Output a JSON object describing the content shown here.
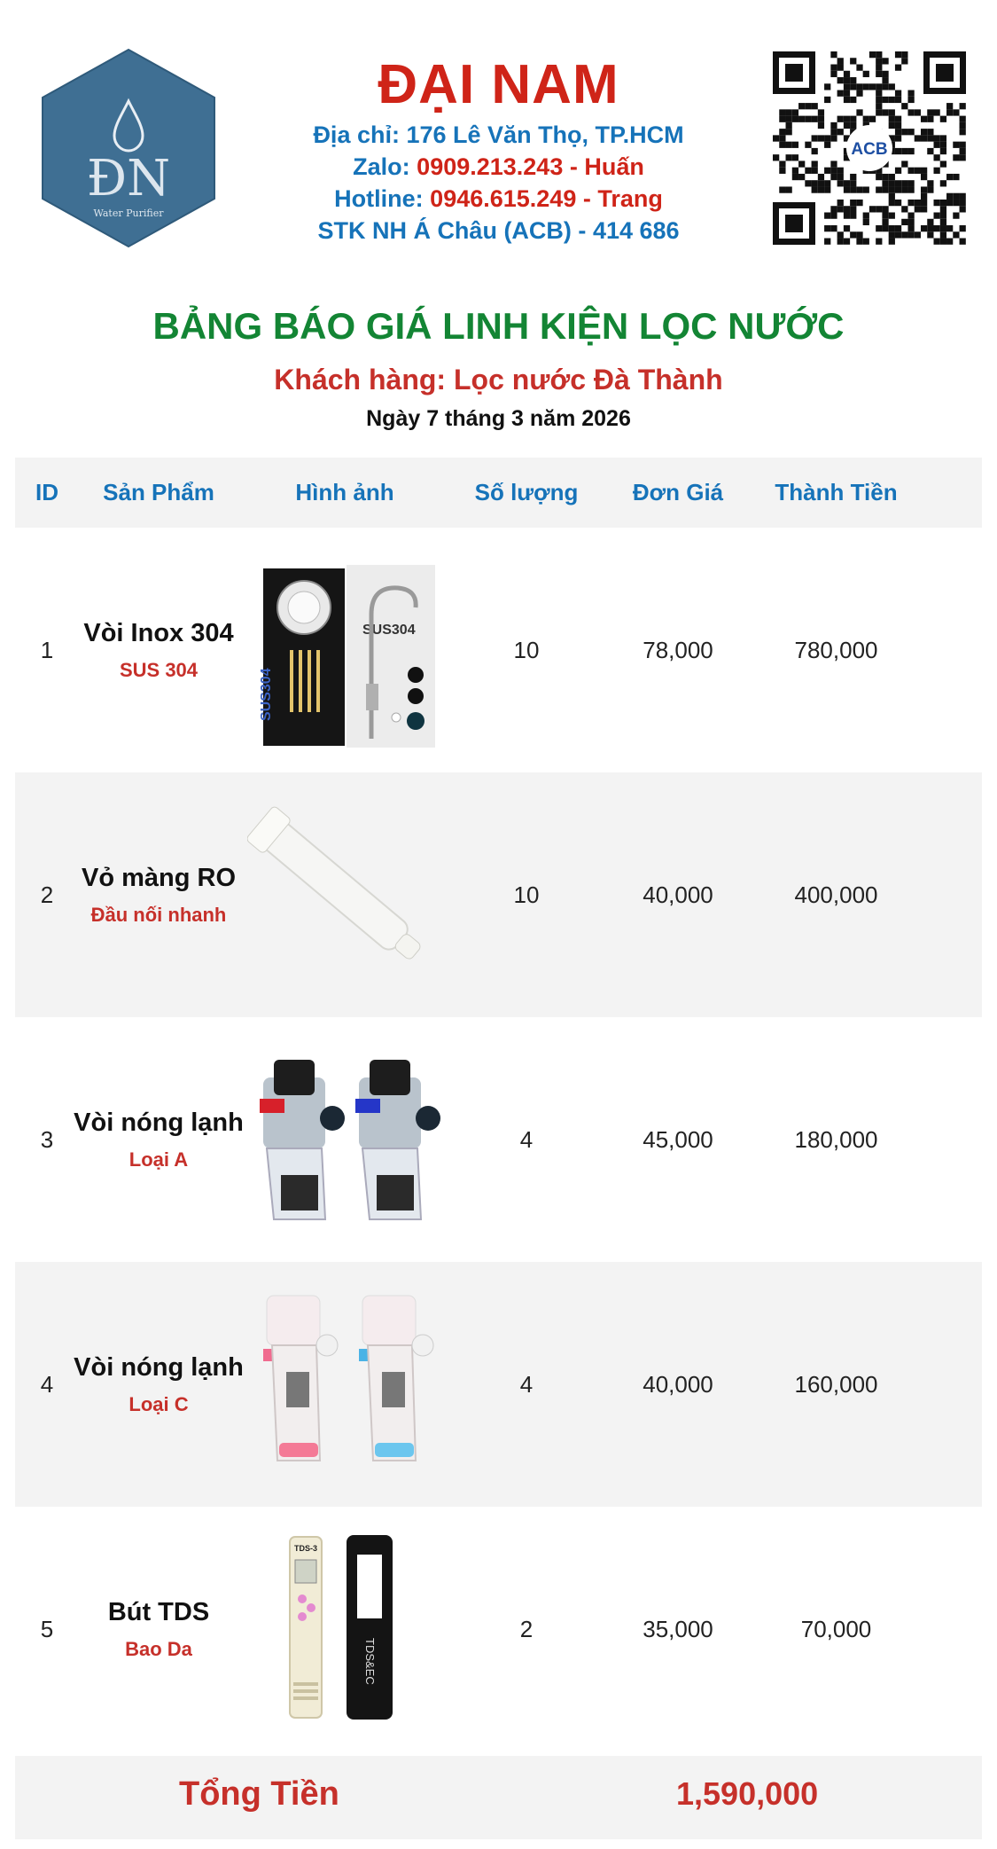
{
  "header": {
    "company_name": "ĐẠI NAM",
    "address_label": "Địa chỉ:",
    "address_value": "176 Lê Văn Thọ, TP.HCM",
    "zalo_label": "Zalo:",
    "zalo_value": "0909.213.243 - Huấn",
    "hotline_label": "Hotline:",
    "hotline_value": "0946.615.249 - Trang",
    "bank_label": "STK NH Á Châu (ACB) -",
    "bank_value": "414 686",
    "logo_text": "ĐN",
    "logo_subtext": "Water Purifier",
    "qr_badge": "ACB"
  },
  "title": "BẢNG BÁO GIÁ LINH KIỆN LỌC NƯỚC",
  "customer": "Khách hàng: Lọc nước Đà Thành",
  "date": "Ngày 7 tháng 3 năm 2026",
  "table": {
    "headers": [
      "ID",
      "Sản Phẩm",
      "Hình ảnh",
      "Số lượng",
      "Đơn Giá",
      "Thành Tiền"
    ],
    "rows": [
      {
        "id": "1",
        "name": "Vòi Inox 304",
        "sub": "SUS 304",
        "image": "faucet-box-image",
        "qty": "10",
        "price": "78,000",
        "total": "780,000"
      },
      {
        "id": "2",
        "name": "Vỏ màng RO",
        "sub": "Đầu nối nhanh",
        "image": "ro-housing-image",
        "qty": "10",
        "price": "40,000",
        "total": "400,000"
      },
      {
        "id": "3",
        "name": "Vòi nóng lạnh",
        "sub": "Loại A",
        "image": "hot-cold-tap-a-image",
        "qty": "4",
        "price": "45,000",
        "total": "180,000"
      },
      {
        "id": "4",
        "name": "Vòi nóng lạnh",
        "sub": "Loại C",
        "image": "hot-cold-tap-c-image",
        "qty": "4",
        "price": "40,000",
        "total": "160,000"
      },
      {
        "id": "5",
        "name": "Bút TDS",
        "sub": "Bao Da",
        "image": "tds-pen-image",
        "qty": "2",
        "price": "35,000",
        "total": "70,000"
      }
    ]
  },
  "product_image_text": {
    "sus_label": "SUS304",
    "sus_vertical": "SUS304",
    "tds_label": "TDS-3",
    "tds_case": "TDS&EC"
  },
  "total": {
    "label": "Tổng Tiền",
    "value": "1,590,000"
  },
  "colors": {
    "red": "#cf2418",
    "blue": "#1673b9",
    "green": "#138534",
    "row_alt": "#f3f3f3"
  }
}
